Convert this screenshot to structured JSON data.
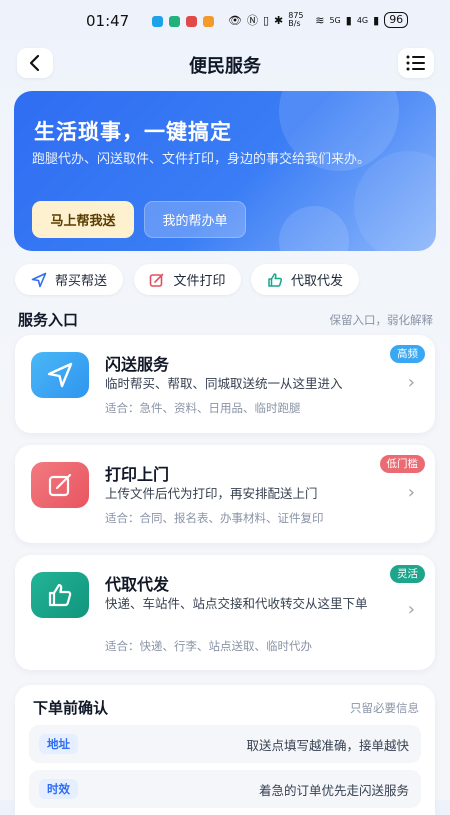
{
  "status_bar": {
    "time": "01:47",
    "net_speed": "875 B/s",
    "signal_1": "5G",
    "signal_2": "4G",
    "battery": "96"
  },
  "nav": {
    "title": "便民服务",
    "back_icon": "back-arrow-icon",
    "menu_icon": "list-menu-icon"
  },
  "hero": {
    "title": "生活琐事，一键搞定",
    "description": "跑腿代办、闪送取件、文件打印，身边的事交给我们来办。",
    "primary_button": "马上帮我送",
    "secondary_button": "我的帮办单",
    "colors": {
      "start": "#2f6df2",
      "end": "#8fb8fb"
    }
  },
  "quick_actions": [
    {
      "label": "帮买帮送",
      "icon": "send-icon"
    },
    {
      "label": "文件打印",
      "icon": "edit-icon"
    },
    {
      "label": "代取代发",
      "icon": "thumb-up-icon"
    }
  ],
  "services_section": {
    "title": "服务入口",
    "hint": "保留入口，弱化解释",
    "items": [
      {
        "title": "闪送服务",
        "description": "临时帮买、帮取、同城取送统一从这里进入",
        "meta": "适合：急件、资料、日用品、临时跑腿",
        "badge": "高频",
        "badge_color": "#38a8f2",
        "icon": "send-icon",
        "icon_color": "#3aa6f5"
      },
      {
        "title": "打印上门",
        "description": "上传文件后代为打印，再安排配送上门",
        "meta": "适合：合同、报名表、办事材料、证件复印",
        "badge": "低门槛",
        "badge_color": "#ec6b73",
        "icon": "edit-icon",
        "icon_color": "#ee6b72"
      },
      {
        "title": "代取代发",
        "description": "快递、车站件、站点交接和代收转交从这里下单",
        "meta": "适合：快递、行李、站点送取、临时代办",
        "badge": "灵活",
        "badge_color": "#1ea58b",
        "icon": "thumb-up-icon",
        "icon_color": "#17a58b"
      }
    ]
  },
  "confirm_section": {
    "title": "下单前确认",
    "hint": "只留必要信息",
    "rows": [
      {
        "tag": "地址",
        "text": "取送点填写越准确，接单越快"
      },
      {
        "tag": "时效",
        "text": "着急的订单优先走闪送服务"
      }
    ]
  },
  "colors": {
    "accent": "#2f6df2",
    "background": "#f4f6fa"
  }
}
